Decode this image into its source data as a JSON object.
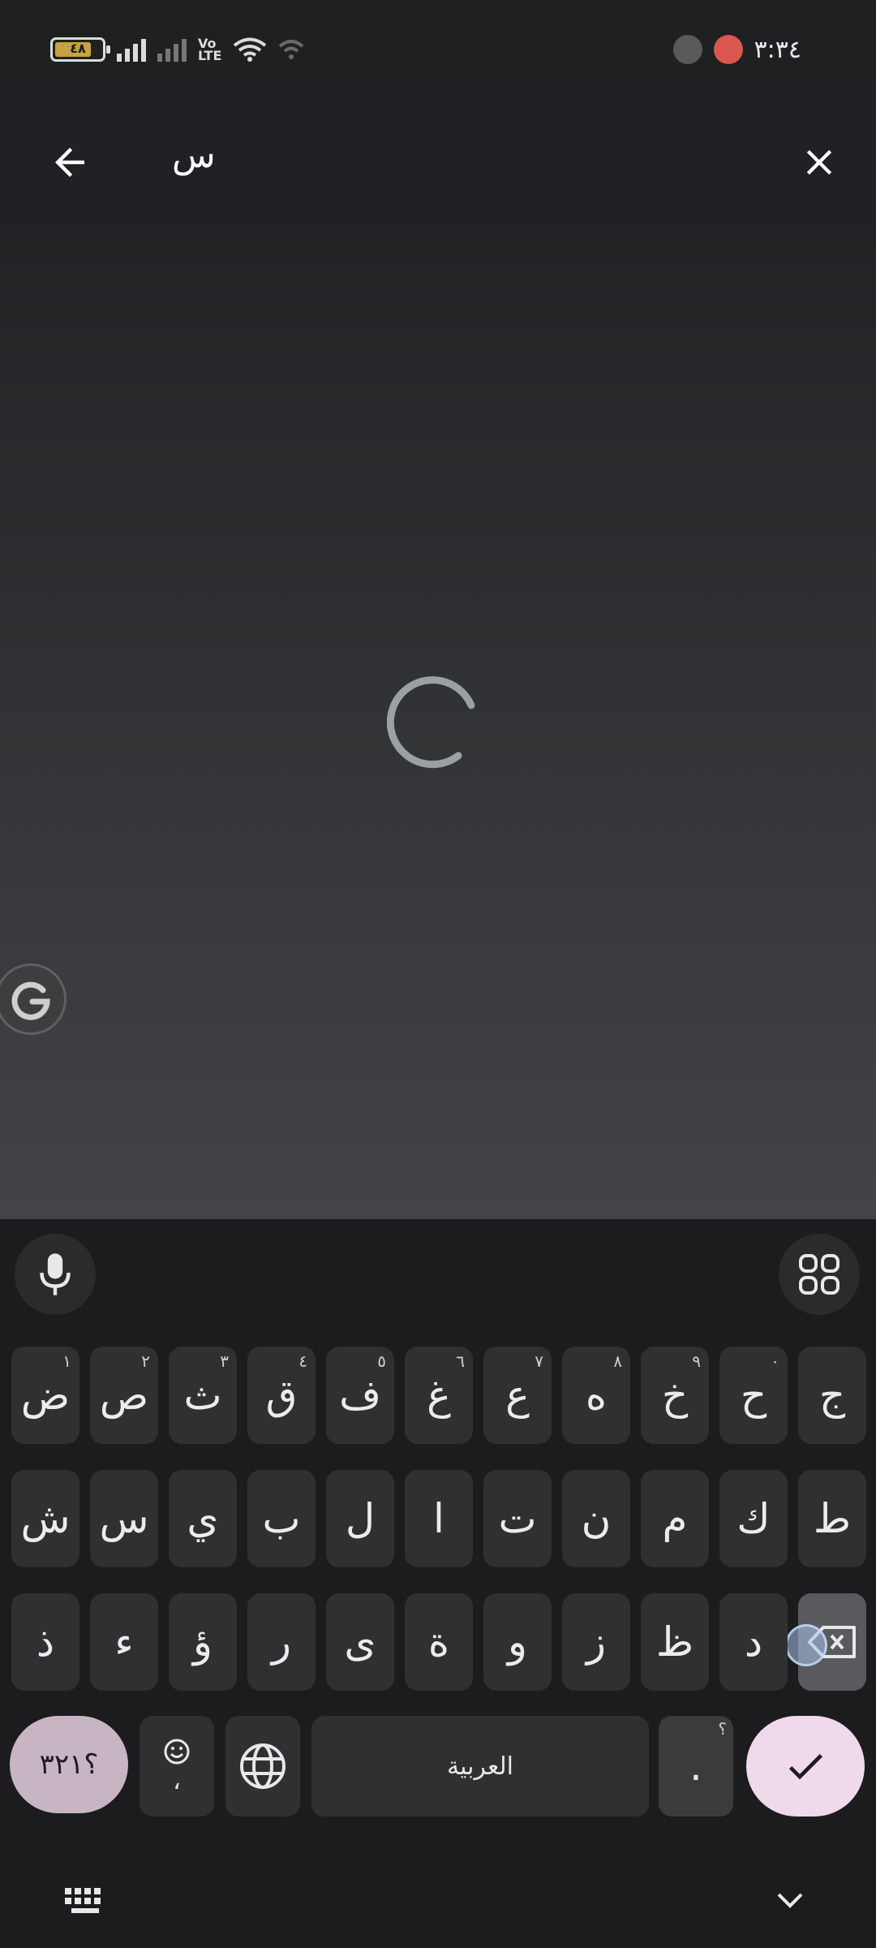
{
  "status_bar": {
    "battery_percent": "٤٨",
    "volte_label_1": "Vo\nLTE",
    "volte_label_2": "Vo\nLTE",
    "time": "٣:٣٤",
    "icons": [
      "battery-icon",
      "signal-icon",
      "wifi-icon",
      "notification-app-icon"
    ]
  },
  "search": {
    "query": "س",
    "back_icon": "arrow-left-icon",
    "clear_icon": "close-icon"
  },
  "content": {
    "loading": true,
    "floating_icon": "grammarly-g-icon"
  },
  "keyboard": {
    "toolbar": {
      "left_icon": "microphone-icon",
      "right_icon": "apps-grid-icon"
    },
    "row1": [
      {
        "label": "ج",
        "hint": ""
      },
      {
        "label": "ح",
        "hint": "٠"
      },
      {
        "label": "خ",
        "hint": "٩"
      },
      {
        "label": "ه",
        "hint": "٨"
      },
      {
        "label": "ع",
        "hint": "٧"
      },
      {
        "label": "غ",
        "hint": "٦"
      },
      {
        "label": "ف",
        "hint": "٥"
      },
      {
        "label": "ق",
        "hint": "٤"
      },
      {
        "label": "ث",
        "hint": "٣"
      },
      {
        "label": "ص",
        "hint": "٢"
      },
      {
        "label": "ض",
        "hint": "١"
      }
    ],
    "row2": [
      "ط",
      "ك",
      "م",
      "ن",
      "ت",
      "ا",
      "ل",
      "ب",
      "ي",
      "س",
      "ش"
    ],
    "row3": [
      "د",
      "ظ",
      "ز",
      "و",
      "ة",
      "ى",
      "ر",
      "ؤ",
      "ء",
      "ذ"
    ],
    "symbols_label": "؟٣٢١",
    "comma_label": "،",
    "space_label": "العربية",
    "period_label": ".",
    "period_hint": "؟",
    "accent_color": "#efd9ea",
    "symbols_color": "#c8b5c3"
  },
  "nav": {
    "left_icon": "keyboard-icon",
    "right_icon": "chevron-down-icon"
  }
}
